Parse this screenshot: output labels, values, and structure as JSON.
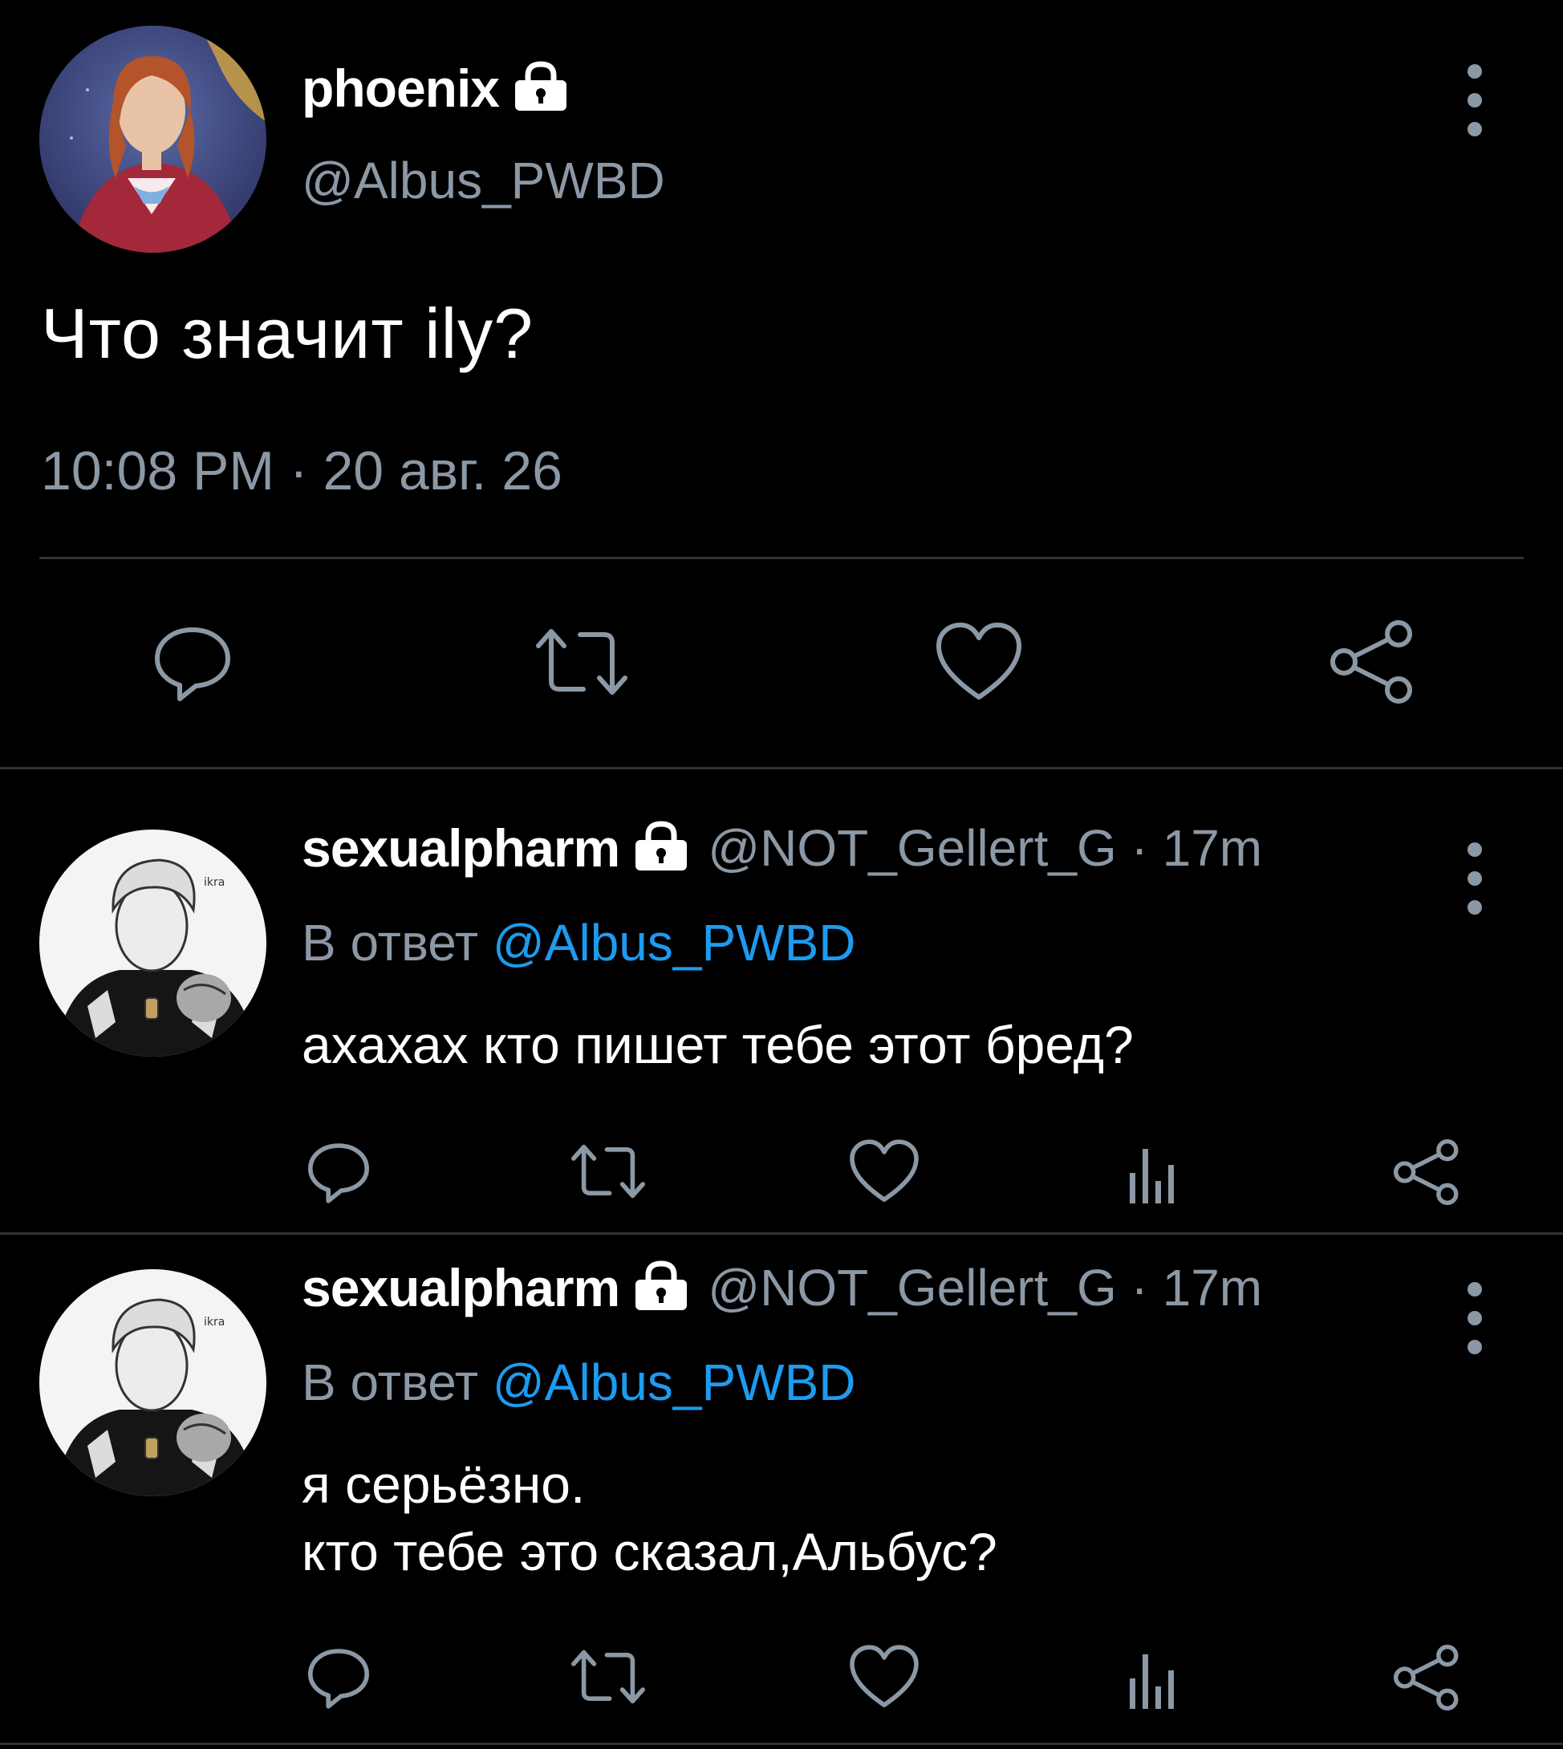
{
  "colors": {
    "background": "#000000",
    "primary_text": "#ffffff",
    "secondary_text": "#8b98a5",
    "link": "#1d9bf0",
    "divider": "#2f3336"
  },
  "main_tweet": {
    "display_name": "phoenix",
    "protected_icon": "lock-icon",
    "handle": "@Albus_PWBD",
    "text": "Что значит ily?",
    "timestamp": "10:08 PM · 20 авг. 26",
    "actions": [
      "reply-icon",
      "retweet-icon",
      "like-icon",
      "share-icon"
    ]
  },
  "replies": [
    {
      "display_name": "sexualpharm",
      "protected_icon": "lock-icon",
      "meta": "@NOT_Gellert_G · 17m",
      "reply_prefix": "В ответ",
      "reply_mention": "@Albus_PWBD",
      "lines": [
        "ахахах кто пишет тебе этот бред?"
      ],
      "actions": [
        "reply-icon",
        "retweet-icon",
        "like-icon",
        "analytics-icon",
        "share-icon"
      ]
    },
    {
      "display_name": "sexualpharm",
      "protected_icon": "lock-icon",
      "meta": "@NOT_Gellert_G · 17m",
      "reply_prefix": "В ответ",
      "reply_mention": "@Albus_PWBD",
      "lines": [
        "я серьёзно.",
        "кто тебе это сказал,Альбус?"
      ],
      "actions": [
        "reply-icon",
        "retweet-icon",
        "like-icon",
        "analytics-icon",
        "share-icon"
      ]
    }
  ]
}
